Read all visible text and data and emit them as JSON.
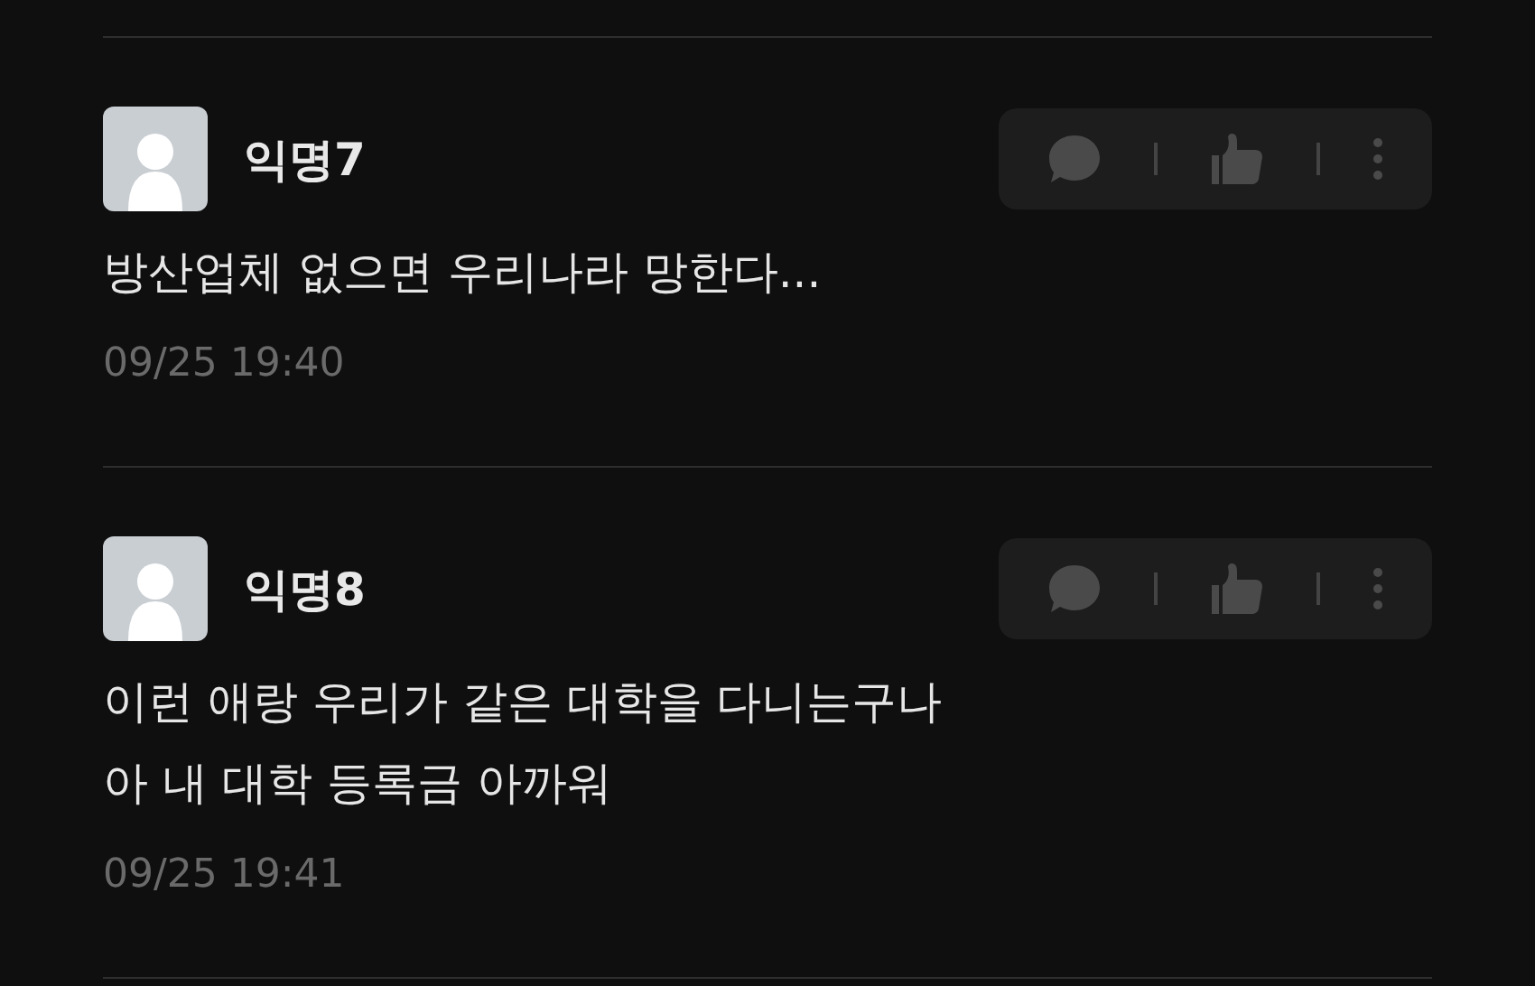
{
  "comments": [
    {
      "author": "익명7",
      "text": [
        "방산업체 없으면 우리나라 망한다..."
      ],
      "time": "09/25 19:40"
    },
    {
      "author": "익명8",
      "text": [
        "이런 애랑 우리가 같은 대학을 다니는구나",
        "아 내 대학 등록금 아까워"
      ],
      "time": "09/25 19:41"
    }
  ]
}
